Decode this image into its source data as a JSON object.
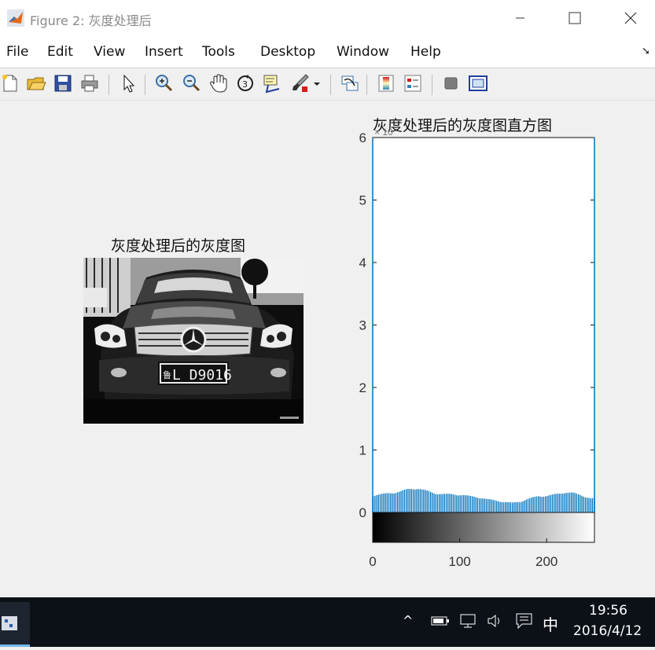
{
  "window": {
    "title": "Figure 2: 灰度处理后"
  },
  "menu": [
    "File",
    "Edit",
    "View",
    "Insert",
    "Tools",
    "Desktop",
    "Window",
    "Help"
  ],
  "toolbar": [
    "new-figure",
    "open-file",
    "save",
    "print",
    "edit-plot",
    "zoom-in",
    "zoom-out",
    "pan",
    "rotate-3d",
    "data-cursor",
    "brush",
    "link-plot",
    "insert-colorbar",
    "insert-legend",
    "hide-plot-tools",
    "show-plot-tools"
  ],
  "figure": {
    "left_title": "灰度处理后的灰度图",
    "plate_text": "L D9016",
    "plate_prefix": "鲁",
    "right_title": "灰度处理后的灰度图直方图",
    "exponent_label": "× 10",
    "accent_color": "#0072bd"
  },
  "chart_data": {
    "type": "bar",
    "title": "灰度处理后的灰度图直方图",
    "xlim": [
      0,
      255
    ],
    "ylim": [
      0,
      6
    ],
    "x_ticks": [
      0,
      100,
      200
    ],
    "y_ticks": [
      0,
      1,
      2,
      3,
      4,
      5,
      6
    ],
    "y_exponent": "× 10^4",
    "bins_x": [
      0,
      10,
      20,
      30,
      40,
      50,
      60,
      70,
      80,
      90,
      100,
      110,
      120,
      130,
      140,
      150,
      160,
      170,
      180,
      190,
      200,
      210,
      220,
      230,
      240,
      250
    ],
    "bins_y": [
      0.28,
      0.3,
      0.32,
      0.34,
      0.38,
      0.4,
      0.36,
      0.32,
      0.3,
      0.3,
      0.29,
      0.27,
      0.25,
      0.22,
      0.2,
      0.17,
      0.16,
      0.18,
      0.23,
      0.27,
      0.27,
      0.3,
      0.33,
      0.32,
      0.28,
      0.23
    ],
    "colorbar": "grayscale 0-255"
  },
  "taskbar": {
    "time": "19:56",
    "date": "2016/4/12",
    "ime": "中"
  }
}
